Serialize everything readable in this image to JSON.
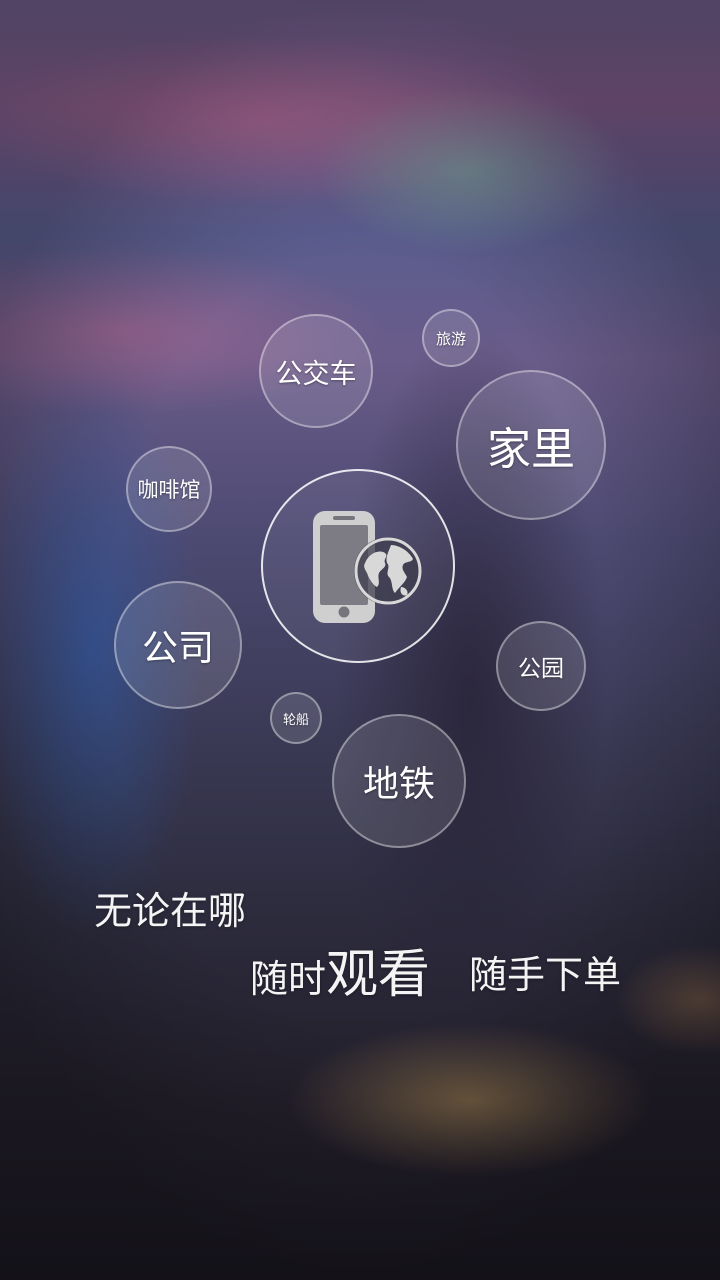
{
  "bubbles": {
    "bus": "公交车",
    "travel": "旅游",
    "home": "家里",
    "cafe": "咖啡馆",
    "company": "公司",
    "park": "公园",
    "ship": "轮船",
    "subway": "地铁"
  },
  "center_icon": "phone-globe-icon",
  "tagline": {
    "line1": "无论在哪",
    "line2_prefix": "随时",
    "line2_emphasis": "观看",
    "line2_suffix": "随手下单"
  }
}
